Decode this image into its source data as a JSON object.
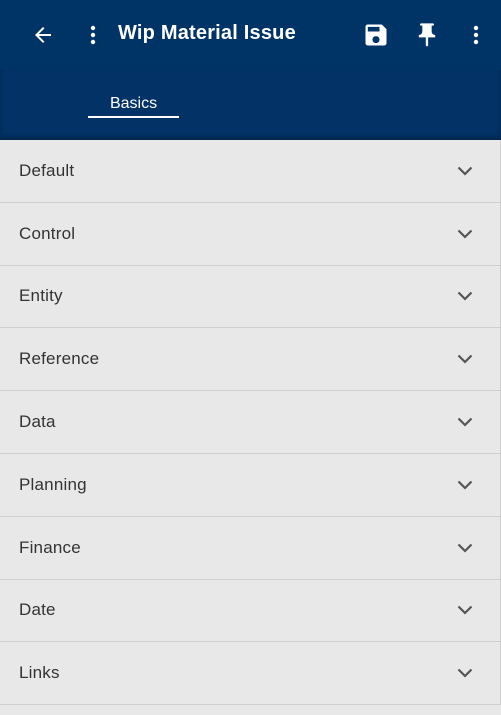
{
  "header": {
    "title": "Wip Material Issue",
    "background": "#003366",
    "icons": [
      "back-arrow-icon",
      "more-vert-icon",
      "save-icon",
      "pin-icon",
      "more-vert-icon"
    ]
  },
  "tabs": [
    {
      "label": "Basics",
      "active": true
    }
  ],
  "sections": [
    {
      "label": "Default"
    },
    {
      "label": "Control"
    },
    {
      "label": "Entity"
    },
    {
      "label": "Reference"
    },
    {
      "label": "Data"
    },
    {
      "label": "Planning"
    },
    {
      "label": "Finance"
    },
    {
      "label": "Date"
    },
    {
      "label": "Links"
    }
  ]
}
